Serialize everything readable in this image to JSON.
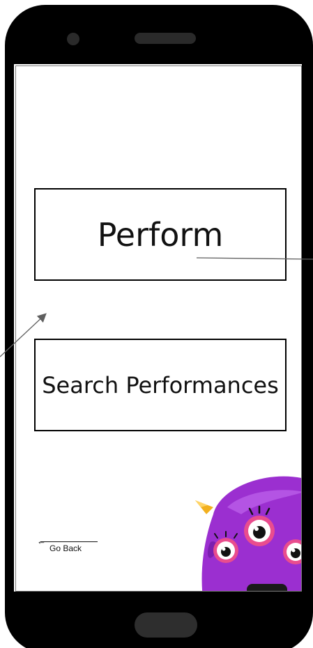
{
  "screen": {
    "perform_label": "Perform",
    "search_performances_label": "Search Performances",
    "go_back_label": "Go Back",
    "go_back_arrow": "←"
  },
  "icons": {
    "mascot": "purple-monster-mascot-icon"
  },
  "colors": {
    "device_frame": "#000000",
    "button_border": "#000000",
    "mascot_fur": "#9b2fd0",
    "mascot_horn": "#f2b01e",
    "mascot_eye_ring": "#e94d8e"
  }
}
